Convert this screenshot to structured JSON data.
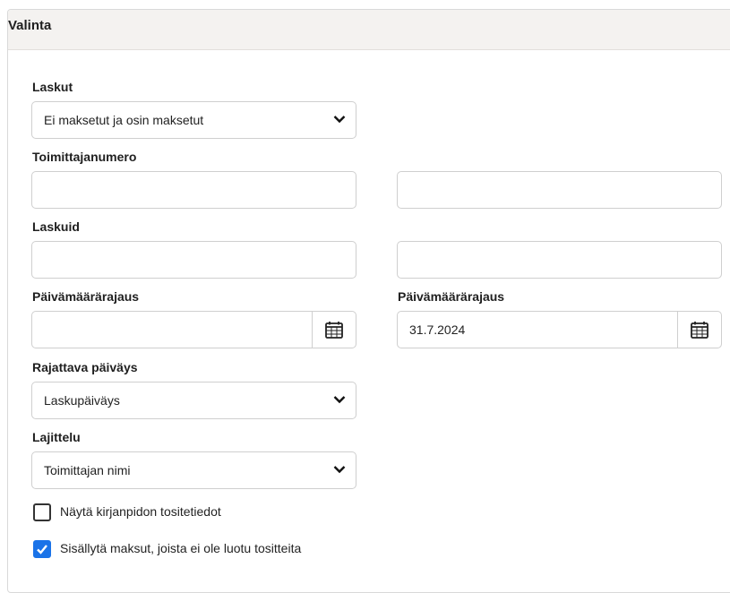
{
  "panel": {
    "title": "Valinta"
  },
  "invoices": {
    "label": "Laskut",
    "value": "Ei maksetut ja osin maksetut"
  },
  "supplier_number": {
    "label": "Toimittajanumero",
    "from": "",
    "to": ""
  },
  "invoice_id": {
    "label": "Laskuid",
    "from": "",
    "to": ""
  },
  "date_range": {
    "from_label": "Päivämäärärajaus",
    "from_value": "",
    "to_label": "Päivämäärärajaus",
    "to_value": "31.7.2024"
  },
  "date_type": {
    "label": "Rajattava päiväys",
    "value": "Laskupäiväys"
  },
  "sorting": {
    "label": "Lajittelu",
    "value": "Toimittajan nimi"
  },
  "show_accounting": {
    "label": "Näytä kirjanpidon tositetiedot",
    "checked": false
  },
  "include_payments": {
    "label": "Sisällytä maksut, joista ei ole luotu tositteita",
    "checked": true
  },
  "colors": {
    "accent": "#1a73e8",
    "header_bg": "#f4f2f0"
  }
}
